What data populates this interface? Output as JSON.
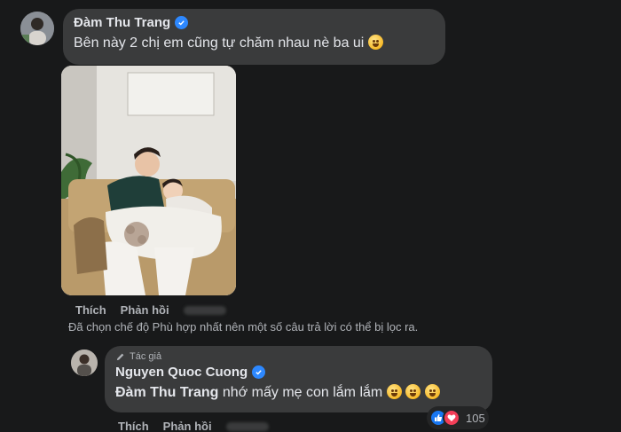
{
  "comment": {
    "author": "Đàm Thu Trang",
    "text": "Bên này 2 chị em cũng tự chăm nhau nè ba ui",
    "actions": {
      "like": "Thích",
      "reply": "Phản hồi"
    }
  },
  "filter_notice": "Đã chọn chế độ Phù hợp nhất nên một số câu trả lời có thể bị lọc ra.",
  "reply": {
    "author_tag": "Tác giả",
    "author": "Nguyen Quoc Cuong",
    "mention": "Đàm Thu Trang",
    "text": "nhớ mấy mẹ con lắm lắm",
    "reaction_count": "105",
    "actions": {
      "like": "Thích",
      "reply": "Phản hồi"
    }
  },
  "colors": {
    "background": "#18191a",
    "bubble": "#3a3b3c",
    "verified": "#2d88ff"
  }
}
